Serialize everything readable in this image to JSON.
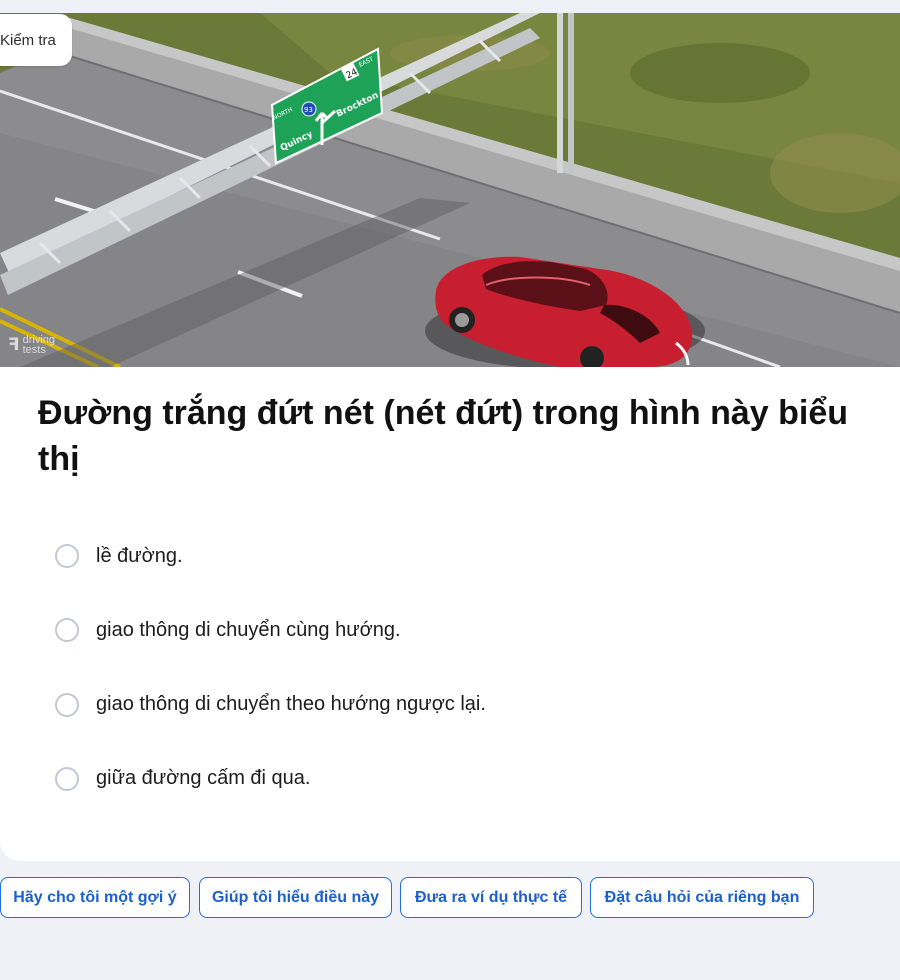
{
  "header": {
    "mode_tab_label": "Kiểm tra"
  },
  "image": {
    "sign": {
      "direction_label": "NORTH",
      "route_left": "93",
      "route_right": "24",
      "direction_right": "EAST",
      "destination_left": "Quincy",
      "destination_right": "Brockton"
    },
    "watermark": {
      "line1": "driving",
      "line2": "tests"
    }
  },
  "question": {
    "text": "Đường trắng đứt nét (nét đứt) trong hình này biểu thị"
  },
  "options": [
    {
      "label": "lề đường."
    },
    {
      "label": "giao thông di chuyển cùng hướng."
    },
    {
      "label": "giao thông di chuyển theo hướng ngược lại."
    },
    {
      "label": "giữa đường cấm đi qua."
    }
  ],
  "help_buttons": [
    {
      "label": "Hãy cho tôi một gợi ý"
    },
    {
      "label": "Giúp tôi hiểu điều này"
    },
    {
      "label": "Đưa ra ví dụ thực tế"
    },
    {
      "label": "Đặt câu hỏi của riêng bạn"
    }
  ],
  "colors": {
    "page_background": "#f0f1f6",
    "accent_blue": "#1f6fde",
    "sign_green": "#1ea257",
    "car_red": "#c81f30"
  }
}
